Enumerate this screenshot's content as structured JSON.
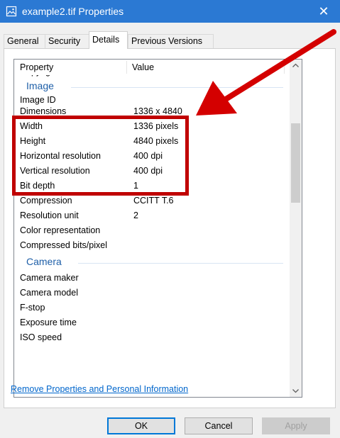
{
  "window": {
    "title": "example2.tif Properties",
    "close_glyph": "✕",
    "accent": "#2b79d3"
  },
  "tabs": [
    {
      "label": "General"
    },
    {
      "label": "Security"
    },
    {
      "label": "Details"
    },
    {
      "label": "Previous Versions"
    }
  ],
  "active_tab": "Details",
  "columns": {
    "property": "Property",
    "value": "Value"
  },
  "rows_top": [
    {
      "property": "Copyright",
      "value": ""
    }
  ],
  "group_image": "Image",
  "image_rows": [
    {
      "property": "Image ID",
      "value": ""
    },
    {
      "property": "Dimensions",
      "value": "1336 x 4840"
    },
    {
      "property": "Width",
      "value": "1336 pixels"
    },
    {
      "property": "Height",
      "value": "4840 pixels"
    },
    {
      "property": "Horizontal resolution",
      "value": "400 dpi"
    },
    {
      "property": "Vertical resolution",
      "value": "400 dpi"
    },
    {
      "property": "Bit depth",
      "value": "1"
    },
    {
      "property": "Compression",
      "value": "CCITT T.6"
    },
    {
      "property": "Resolution unit",
      "value": "2"
    },
    {
      "property": "Color representation",
      "value": ""
    },
    {
      "property": "Compressed bits/pixel",
      "value": ""
    }
  ],
  "group_camera": "Camera",
  "camera_rows": [
    {
      "property": "Camera maker",
      "value": ""
    },
    {
      "property": "Camera model",
      "value": ""
    },
    {
      "property": "F-stop",
      "value": ""
    },
    {
      "property": "Exposure time",
      "value": ""
    },
    {
      "property": "ISO speed",
      "value": ""
    }
  ],
  "link": "Remove Properties and Personal Information",
  "buttons": {
    "ok": "OK",
    "cancel": "Cancel",
    "apply": "Apply"
  },
  "annotation": {
    "color": "#c00000",
    "arrow_color": "#d40000"
  }
}
